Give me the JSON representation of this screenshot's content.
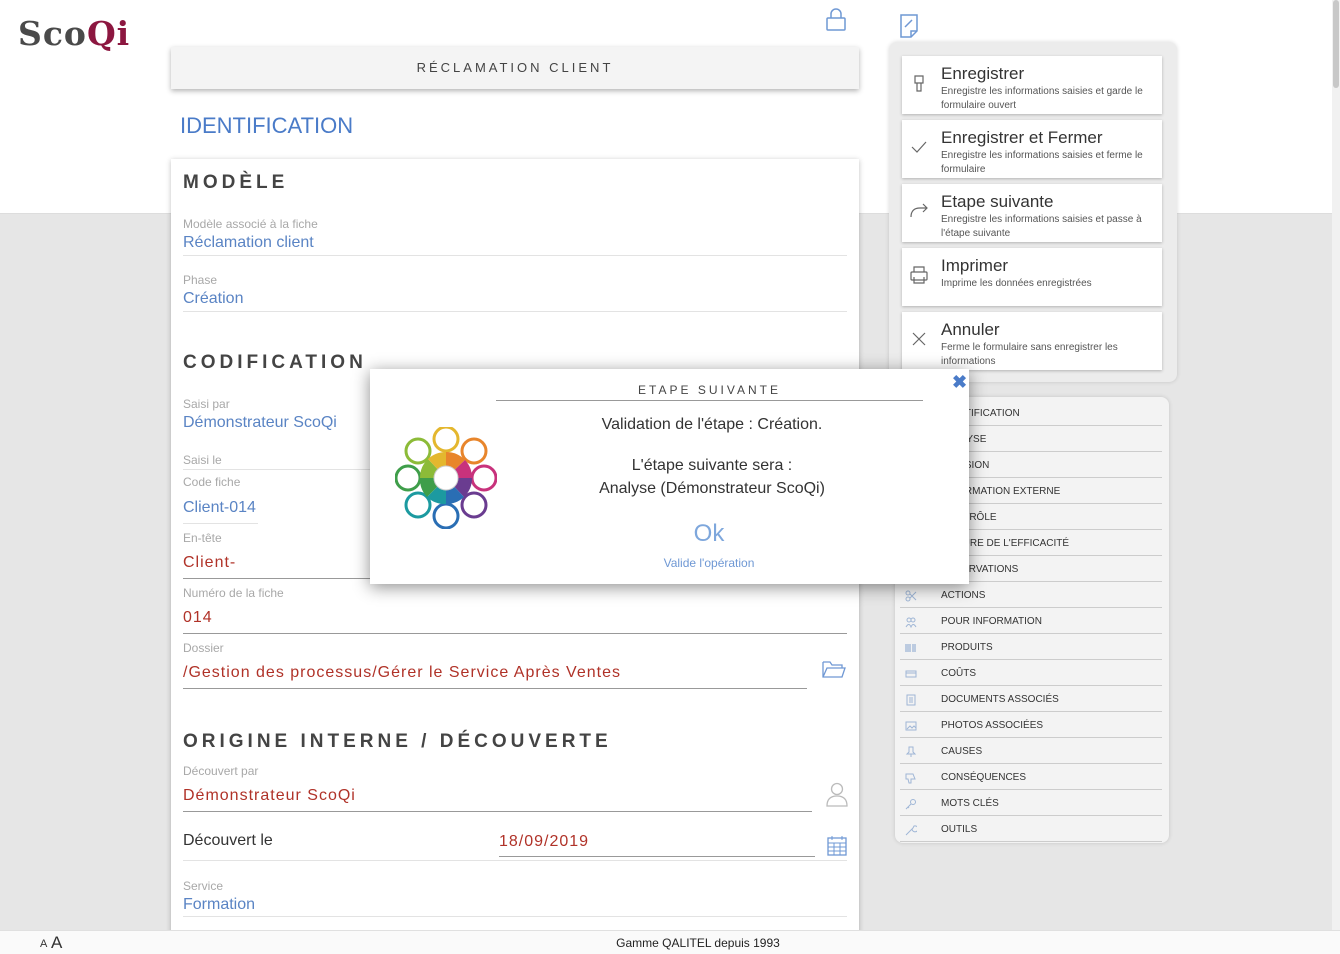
{
  "app": {
    "logo_prefix": "Sco",
    "logo_suffix": "Qi"
  },
  "form": {
    "title": "RÉCLAMATION CLIENT",
    "section_title": "IDENTIFICATION",
    "modele": {
      "heading": "MODÈLE",
      "modele_label": "Modèle associé à la fiche",
      "modele_value": "Réclamation client",
      "phase_label": "Phase",
      "phase_value": "Création"
    },
    "codification": {
      "heading": "CODIFICATION",
      "saisi_par_label": "Saisi par",
      "saisi_par_value": "Démonstrateur ScoQi",
      "saisi_le_label": "Saisi le",
      "code_label": "Code fiche",
      "code_value": "Client-014",
      "dot": ".",
      "entete_label": "En-tête",
      "entete_value": "Client-",
      "numero_label": "Numéro de la fiche",
      "numero_value": "014",
      "dossier_label": "Dossier",
      "dossier_value": "/Gestion des processus/Gérer le Service Après Ventes"
    },
    "origine": {
      "heading": "ORIGINE INTERNE / DÉCOUVERTE",
      "decouvert_par_label": "Découvert par",
      "decouvert_par_value": "Démonstrateur ScoQi",
      "decouvert_le_label": "Découvert le",
      "decouvert_le_value": "18/09/2019",
      "service_label": "Service",
      "service_value": "Formation"
    }
  },
  "actions": [
    {
      "title": "Enregistrer",
      "desc": "Enregistre les informations saisies et garde le formulaire ouvert",
      "icon": "save-icon"
    },
    {
      "title": "Enregistrer et Fermer",
      "desc": "Enregistre les informations saisies et ferme le formulaire",
      "icon": "check-icon"
    },
    {
      "title": "Etape suivante",
      "desc": "Enregistre les informations saisies et passe à l'étape suivante",
      "icon": "forward-arrow-icon"
    },
    {
      "title": "Imprimer",
      "desc": "Imprime les données enregistrées",
      "icon": "printer-icon"
    },
    {
      "title": "Annuler",
      "desc": "Ferme le formulaire sans enregistrer les informations",
      "icon": "close-icon"
    }
  ],
  "nav": [
    {
      "label": "IDENTIFICATION",
      "icon": "identification-icon"
    },
    {
      "label": "ANALYSE",
      "icon": "analysis-icon"
    },
    {
      "label": "DÉCISION",
      "icon": "decision-icon"
    },
    {
      "label": "INFORMATION EXTERNE",
      "icon": "external-info-icon"
    },
    {
      "label": "CONTRÔLE",
      "icon": "control-icon"
    },
    {
      "label": "MESURE DE L'EFFICACITÉ",
      "icon": "efficiency-icon"
    },
    {
      "label": "OBSERVATIONS",
      "icon": "observations-icon"
    },
    {
      "label": "ACTIONS",
      "icon": "scissors-icon"
    },
    {
      "label": "POUR INFORMATION",
      "icon": "people-icon"
    },
    {
      "label": "PRODUITS",
      "icon": "barcode-icon"
    },
    {
      "label": "COÛTS",
      "icon": "money-icon"
    },
    {
      "label": "DOCUMENTS ASSOCIÉS",
      "icon": "document-icon"
    },
    {
      "label": "PHOTOS ASSOCIÉES",
      "icon": "photo-icon"
    },
    {
      "label": "CAUSES",
      "icon": "pin-icon"
    },
    {
      "label": "CONSÉQUENCES",
      "icon": "thumb-down-icon"
    },
    {
      "label": "MOTS CLÉS",
      "icon": "key-icon"
    },
    {
      "label": "OUTILS",
      "icon": "wrench-icon"
    }
  ],
  "modal": {
    "title": "ETAPE SUIVANTE",
    "message_line1": "Validation de l'étape : Création.",
    "message_line2": "L'étape suivante sera :",
    "message_line3": "Analyse (Démonstrateur ScoQi)",
    "ok_label": "Ok",
    "ok_sublabel": "Valide l'opération",
    "close_glyph": "✖"
  },
  "footer": {
    "font_small": "A",
    "font_large": "A",
    "text": "Gamme QALITEL depuis 1993"
  },
  "colors": {
    "accent_blue": "#4a7bc8",
    "value_red": "#b03228",
    "logo_red": "#8c1740"
  }
}
